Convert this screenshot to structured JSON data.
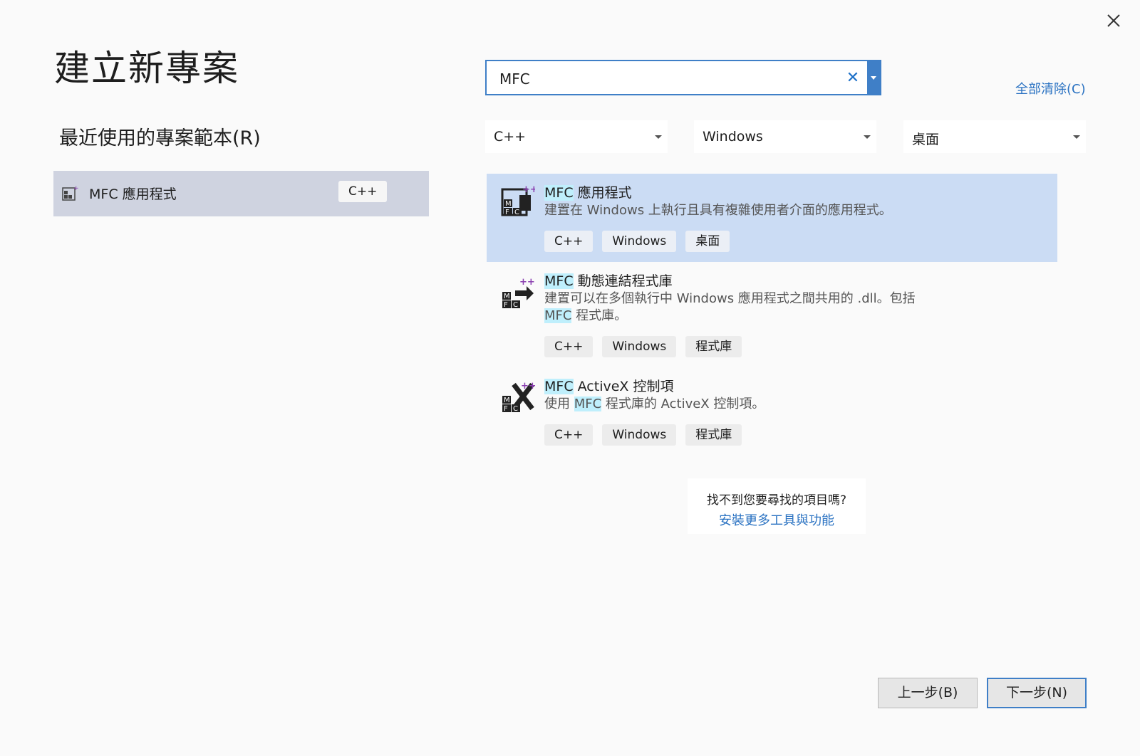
{
  "window": {
    "close_icon": "close-icon"
  },
  "page_title": "建立新專案",
  "recent": {
    "heading": "最近使用的專案範本(R)",
    "items": [
      {
        "label": "MFC 應用程式",
        "tag": "C++",
        "icon": "mfc-app-icon"
      }
    ]
  },
  "search": {
    "value": "MFC",
    "clear_icon": "✕",
    "clear_all": "全部清除(C)"
  },
  "filters": [
    {
      "value": "C++"
    },
    {
      "value": "Windows"
    },
    {
      "value": "桌面"
    }
  ],
  "results": [
    {
      "name_hl": "MFC",
      "name_rest": " 應用程式",
      "desc_line1": "建置在 Windows 上執行且具有複雜使用者介面的應用程式。",
      "tags": [
        "C++",
        "Windows",
        "桌面"
      ],
      "icon": "mfc-app-icon",
      "selected": true
    },
    {
      "name_hl": "MFC",
      "name_rest": " 動態連結程式庫",
      "desc_line1": "建置可以在多個執行中 Windows 應用程式之間共用的 .dll。包括",
      "desc_line2_hl": "MFC",
      "desc_line2_rest": " 程式庫。",
      "tags": [
        "C++",
        "Windows",
        "程式庫"
      ],
      "icon": "mfc-dll-icon",
      "selected": false
    },
    {
      "name_hl": "MFC",
      "name_rest": " ActiveX 控制項",
      "desc_pre": "使用 ",
      "desc_hl": "MFC",
      "desc_post": " 程式庫的 ActiveX 控制項。",
      "tags": [
        "C++",
        "Windows",
        "程式庫"
      ],
      "icon": "mfc-activex-icon",
      "selected": false
    }
  ],
  "not_found": {
    "question": "找不到您要尋找的項目嗎?",
    "link": "安裝更多工具與功能"
  },
  "buttons": {
    "back": "上一步(B)",
    "next": "下一步(N)"
  },
  "colors": {
    "accent": "#3f7fc7",
    "selection": "#cbdcf4",
    "highlight": "#bfeffc",
    "link": "#2a72c2"
  }
}
